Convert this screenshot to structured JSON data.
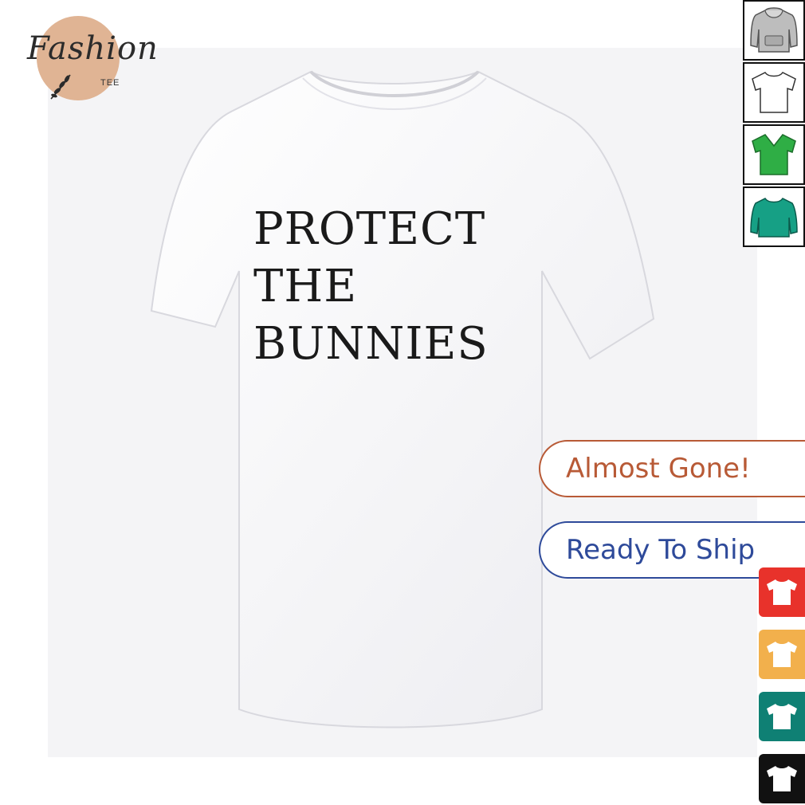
{
  "brand": {
    "script": "Fashion",
    "sub": "TEE",
    "blob_color": "#e0b494"
  },
  "product": {
    "shirt_color": "#ffffff",
    "print_lines": [
      "PROTECT",
      "THE",
      "BUNNIES"
    ]
  },
  "style_thumbnails": [
    {
      "icon": "hoodie-icon",
      "color": "#bdbdbd"
    },
    {
      "icon": "tshirt-icon",
      "color": "#ffffff"
    },
    {
      "icon": "vneck-icon",
      "color": "#2fae45"
    },
    {
      "icon": "sweatshirt-icon",
      "color": "#16a085"
    }
  ],
  "badges": {
    "almost_gone": "Almost Gone!",
    "ready_to_ship": "Ready To Ship",
    "almost_gone_color": "#b85a36",
    "ready_to_ship_color": "#2e4a9a"
  },
  "color_swatches": [
    {
      "icon": "tshirt-icon",
      "color": "#e8322b"
    },
    {
      "icon": "tshirt-icon",
      "color": "#f2b04c"
    },
    {
      "icon": "tshirt-icon",
      "color": "#0f8074"
    },
    {
      "icon": "tshirt-icon",
      "color": "#111111"
    }
  ]
}
